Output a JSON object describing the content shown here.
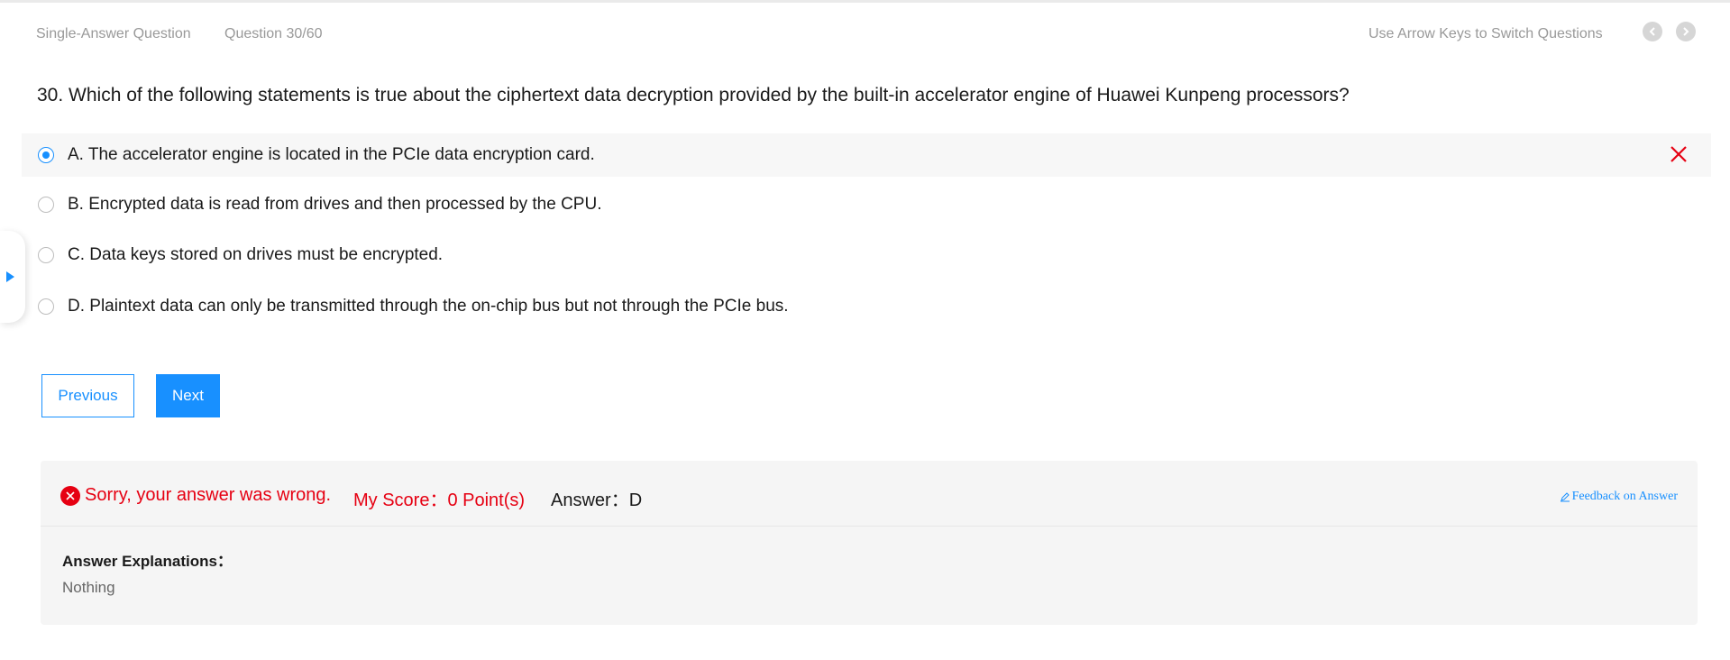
{
  "header": {
    "question_type": "Single-Answer Question",
    "question_progress": "Question 30/60",
    "arrow_hint": "Use Arrow Keys to Switch Questions"
  },
  "question": {
    "title": "30. Which of the following statements is true about the ciphertext data decryption provided by the built-in accelerator engine of Huawei Kunpeng processors?",
    "options": [
      {
        "label": "A. The accelerator engine is located in the PCIe data encryption card.",
        "selected": true,
        "marked_wrong": true
      },
      {
        "label": "B. Encrypted data is read from drives and then processed by the CPU.",
        "selected": false
      },
      {
        "label": "C. Data keys stored on drives must be encrypted.",
        "selected": false
      },
      {
        "label": "D. Plaintext data can only be transmitted through the on-chip bus but not through the PCIe bus.",
        "selected": false
      }
    ]
  },
  "buttons": {
    "previous": "Previous",
    "next": "Next"
  },
  "result": {
    "wrong_message": "Sorry, your answer was wrong.",
    "score": "My Score：0 Point(s)",
    "answer": "Answer：D",
    "feedback_link": "Feedback on Answer",
    "explanation_label": "Answer Explanations：",
    "explanation_value": "Nothing"
  },
  "icons": {
    "nav_prev": "chevron-left-icon",
    "nav_next": "chevron-right-icon",
    "wrong_mark": "close-icon",
    "error_badge": "error-circle-icon",
    "feedback": "edit-icon",
    "side_tab": "caret-right-icon"
  },
  "colors": {
    "accent": "#1890ff",
    "error": "#e60012",
    "muted_text": "#999999"
  }
}
